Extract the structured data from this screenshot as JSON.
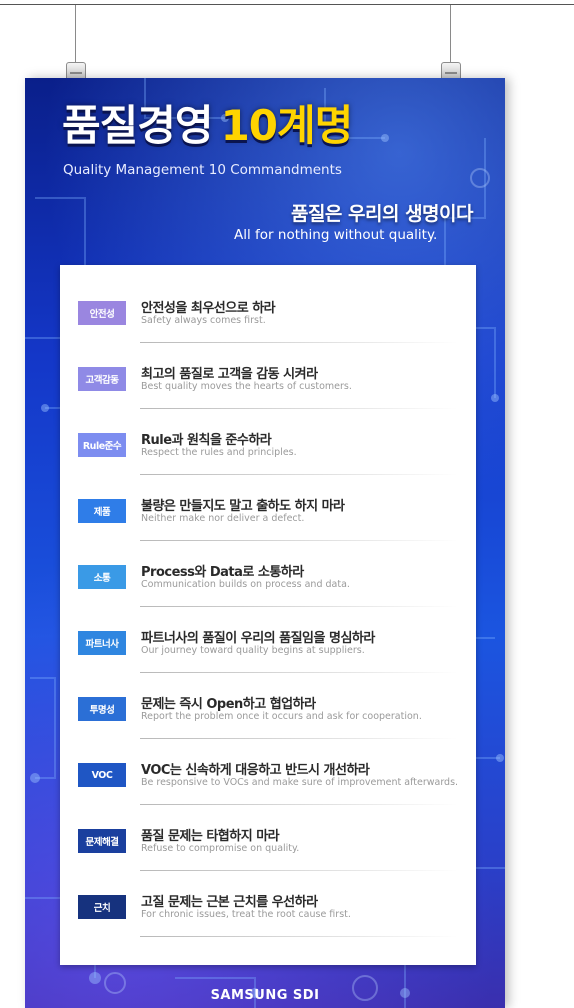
{
  "poster": {
    "title_main": "품질경영",
    "title_highlight": "10계명",
    "subtitle": "Quality Management 10 Commandments",
    "slogan": "품질은 우리의 생명이다",
    "slogan_en": "All for nothing without quality.",
    "footer": "SAMSUNG SDI"
  },
  "items": [
    {
      "badge": "안전성",
      "ko": "안전성을 최우선으로 하라",
      "en": "Safety always comes first.",
      "color": "#9a86e0"
    },
    {
      "badge": "고객감동",
      "ko": "최고의 품질로 고객을 감동 시켜라",
      "en": "Best quality moves the hearts of customers.",
      "color": "#8f8ae6"
    },
    {
      "badge": "Rule준수",
      "ko": "Rule과 원칙을 준수하라",
      "en": "Respect the rules and principles.",
      "color": "#7d8df0"
    },
    {
      "badge": "제품",
      "ko": "불량은 만들지도 말고 출하도 하지 마라",
      "en": "Neither make nor deliver a defect.",
      "color": "#2f7de8"
    },
    {
      "badge": "소통",
      "ko": "Process와 Data로 소통하라",
      "en": "Communication builds on process and data.",
      "color": "#3a9ae6"
    },
    {
      "badge": "파트너사",
      "ko": "파트너사의 품질이 우리의 품질임을 명심하라",
      "en": "Our journey toward quality begins at suppliers.",
      "color": "#2f86e0"
    },
    {
      "badge": "투명성",
      "ko": "문제는 즉시 Open하고 협업하라",
      "en": "Report the problem once it occurs and ask for cooperation.",
      "color": "#2b6fd6"
    },
    {
      "badge": "VOC",
      "ko": "VOC는 신속하게 대응하고 반드시 개선하라",
      "en": "Be responsive to VOCs and make sure of improvement afterwards.",
      "color": "#1f56c4"
    },
    {
      "badge": "문제해결",
      "ko": "품질 문제는 타협하지 마라",
      "en": "Refuse to compromise on quality.",
      "color": "#1a3f9e"
    },
    {
      "badge": "근치",
      "ko": "고질 문제는 근본 근치를 우선하라",
      "en": "For chronic issues, treat the root cause first.",
      "color": "#16327e"
    }
  ]
}
